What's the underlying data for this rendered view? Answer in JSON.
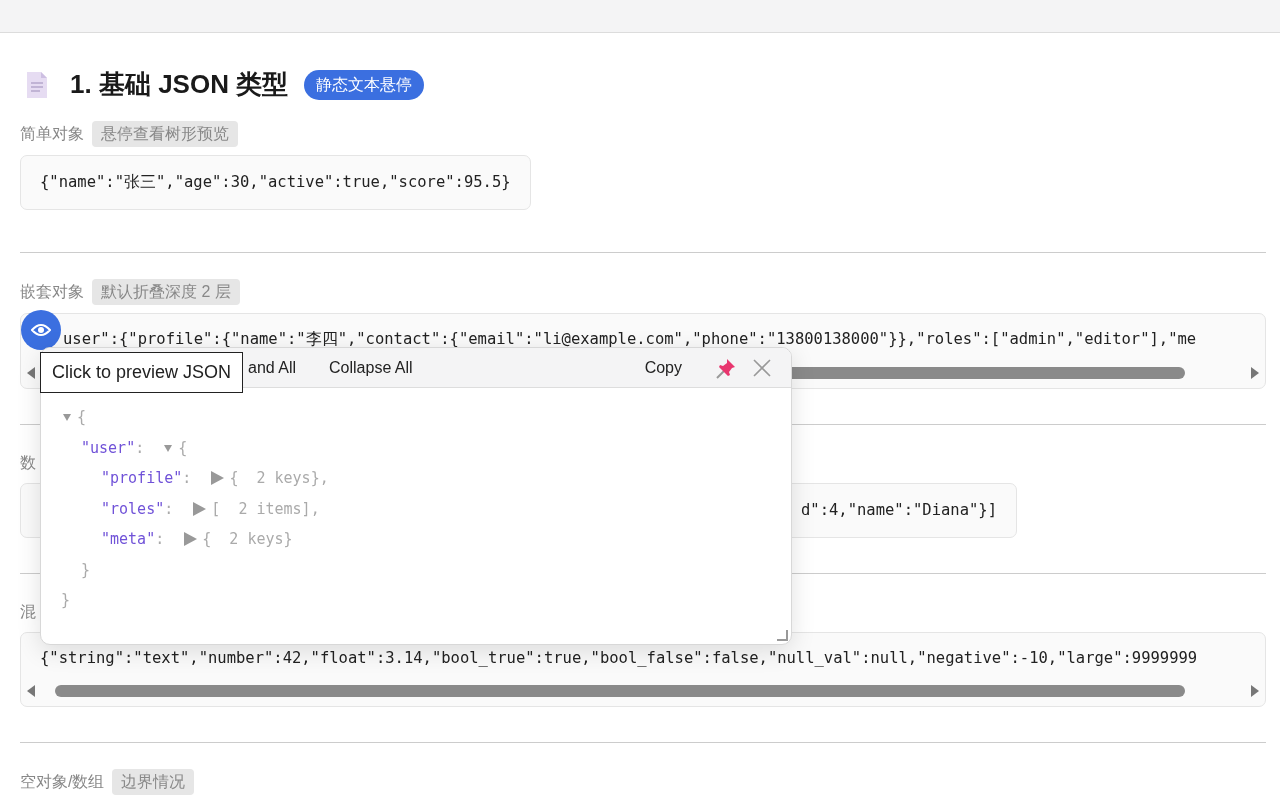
{
  "header": {
    "title": "1. 基础 JSON 类型",
    "badge": "静态文本悬停"
  },
  "sections": [
    {
      "label": "简单对象",
      "tag": "悬停查看树形预览",
      "code": "{\"name\":\"张三\",\"age\":30,\"active\":true,\"score\":95.5}",
      "scrollable": false,
      "covered": false
    },
    {
      "label": "嵌套对象",
      "tag": "默认折叠深度 2 层",
      "code": "user\":{\"profile\":{\"name\":\"李四\",\"contact\":{\"email\":\"li@example.com\",\"phone\":\"13800138000\"}},\"roles\":[\"admin\",\"editor\"],\"me",
      "scrollable": true,
      "covered": false,
      "preview_button": true
    },
    {
      "label": "数",
      "code": "d\":4,\"name\":\"Diana\"}]",
      "scrollable": false,
      "covered": true
    },
    {
      "label": "混",
      "code": "{\"string\":\"text\",\"number\":42,\"float\":3.14,\"bool_true\":true,\"bool_false\":false,\"null_val\":null,\"negative\":-10,\"large\":9999999",
      "scrollable": true,
      "covered": false
    },
    {
      "label": "空对象/数组",
      "tag": "边界情况"
    }
  ],
  "popup": {
    "buttons": [
      "and All",
      "Collapse All"
    ],
    "copy": "Copy",
    "tooltip": "Click to preview JSON",
    "tree": {
      "open": "{",
      "close": "}",
      "expanded": true,
      "children": [
        {
          "key": "\"user\"",
          "colon": ":",
          "open": "{",
          "close": "}",
          "expanded": true,
          "children": [
            {
              "key": "\"profile\"",
              "colon": ":",
              "summary": "{  2 keys},",
              "expanded": false
            },
            {
              "key": "\"roles\"",
              "colon": ":",
              "summary": "[  2 items],",
              "expanded": false
            },
            {
              "key": "\"meta\"",
              "colon": ":",
              "summary": "{  2 keys}",
              "expanded": false
            }
          ]
        }
      ]
    }
  }
}
